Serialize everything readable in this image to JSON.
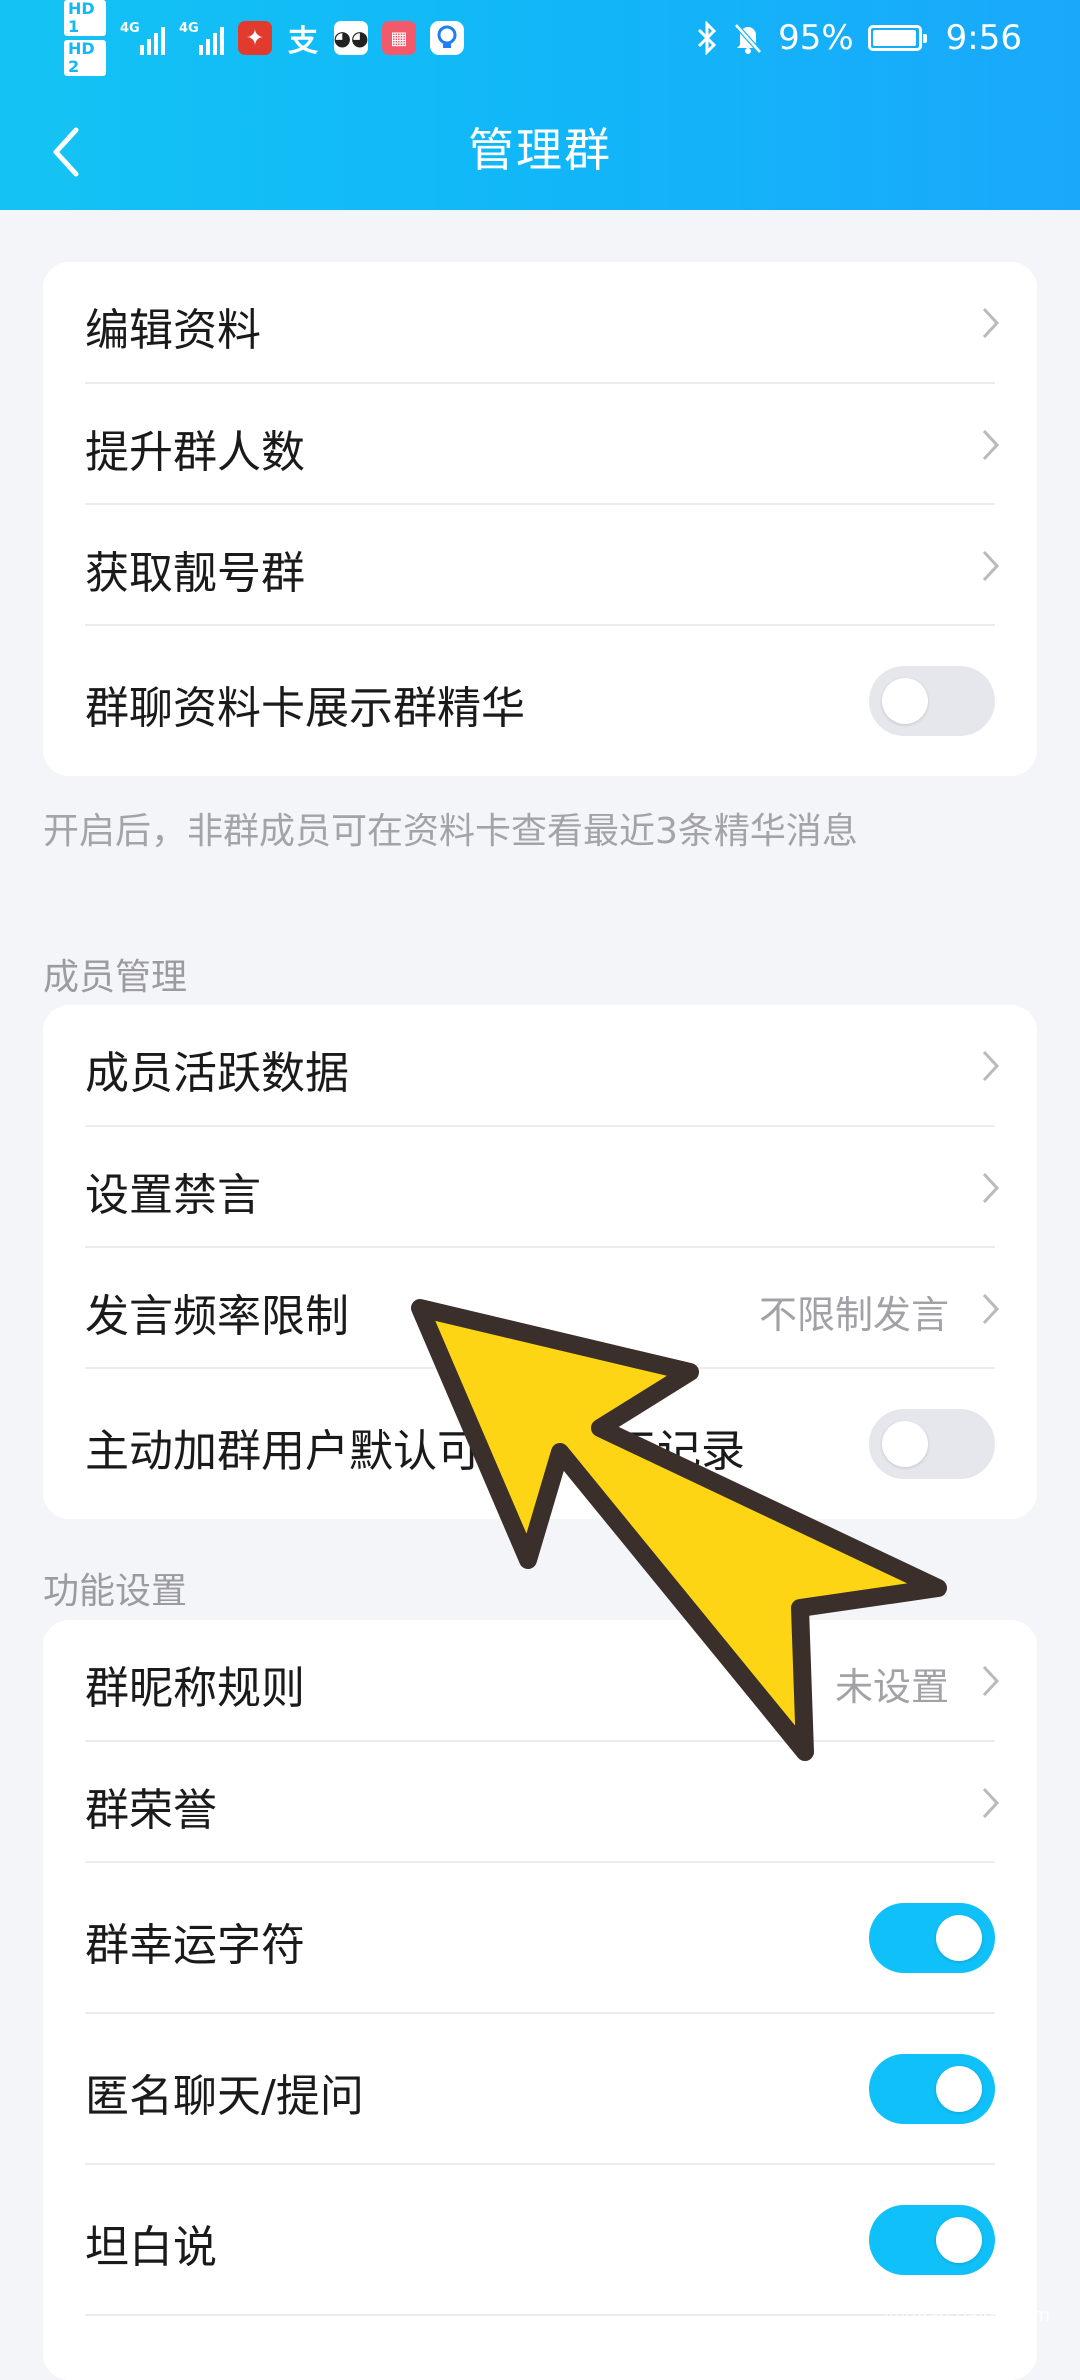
{
  "status_bar": {
    "sim1": "HD 1",
    "sim2": "HD 2",
    "net1": "4G",
    "net2": "4G",
    "app_icons": [
      "xuexi-app-icon",
      "alipay-app-icon",
      "owl-app-icon",
      "book-app-icon",
      "lightbulb-app-icon"
    ],
    "battery": "95%",
    "time": "9:56"
  },
  "nav": {
    "title": "管理群"
  },
  "group1": {
    "rows": [
      {
        "label": "编辑资料"
      },
      {
        "label": "提升群人数"
      },
      {
        "label": "获取靓号群"
      },
      {
        "label": "群聊资料卡展示群精华",
        "toggle": false
      }
    ],
    "note": "开启后，非群成员可在资料卡查看最近3条精华消息"
  },
  "members": {
    "header": "成员管理",
    "rows": [
      {
        "label": "成员活跃数据"
      },
      {
        "label": "设置禁言"
      },
      {
        "label": "发言频率限制",
        "value": "不限制发言"
      },
      {
        "label": "主动加群用户默认可查看聊天记录",
        "toggle": false
      }
    ]
  },
  "features": {
    "header": "功能设置",
    "rows": [
      {
        "label": "群昵称规则",
        "value": "未设置"
      },
      {
        "label": "群荣誉"
      },
      {
        "label": "群幸运字符",
        "toggle": true
      },
      {
        "label": "匿名聊天/提问",
        "toggle": true
      },
      {
        "label": "坦白说",
        "toggle": true
      }
    ]
  },
  "watermark": {
    "brand": "Baidu经验",
    "url": "jingyan.baidu.com"
  },
  "colors": {
    "accent": "#10c0f8",
    "annotation_arrow": "#fdd515"
  }
}
